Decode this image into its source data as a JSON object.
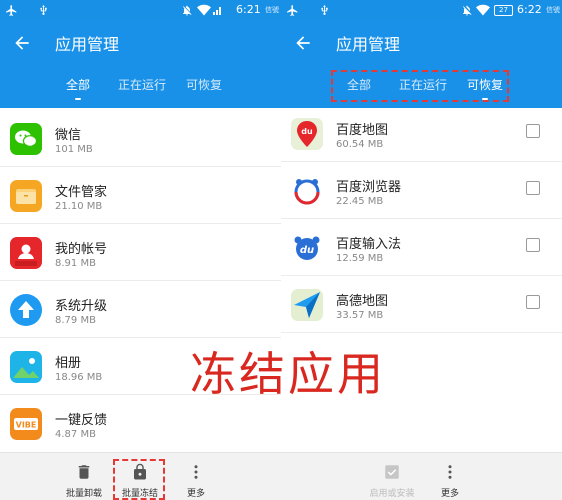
{
  "left": {
    "status": {
      "time": "6:21",
      "carrier_note": "信號"
    },
    "title": "应用管理",
    "tabs": [
      {
        "label": "全部",
        "active": true
      },
      {
        "label": "正在运行",
        "active": false
      },
      {
        "label": "可恢复",
        "active": false
      }
    ],
    "apps": [
      {
        "name": "微信",
        "size": "101 MB",
        "icon": "wechat-icon",
        "color": "#2dc100"
      },
      {
        "name": "文件管家",
        "size": "21.10 MB",
        "icon": "folder-icon",
        "color": "#f5a623"
      },
      {
        "name": "我的帐号",
        "size": "8.91 MB",
        "icon": "lenovo-account-icon",
        "color": "#e5262b"
      },
      {
        "name": "系统升级",
        "size": "8.79 MB",
        "icon": "upgrade-icon",
        "color": "#1e9af0"
      },
      {
        "name": "相册",
        "size": "18.96 MB",
        "icon": "gallery-icon",
        "color": "#1fb4e8"
      },
      {
        "name": "一键反馈",
        "size": "4.87 MB",
        "icon": "vibe-feedback-icon",
        "color": "#f28b1b"
      }
    ],
    "bottom": [
      {
        "label": "批量卸载",
        "icon": "trash-icon"
      },
      {
        "label": "批量冻结",
        "icon": "lock-icon"
      },
      {
        "label": "更多",
        "icon": "more-vertical-icon"
      }
    ]
  },
  "right": {
    "status": {
      "time": "6:22",
      "carrier_note": "信號",
      "battery": "27"
    },
    "title": "应用管理",
    "tabs": [
      {
        "label": "全部",
        "active": false
      },
      {
        "label": "正在运行",
        "active": false
      },
      {
        "label": "可恢复",
        "active": true
      }
    ],
    "apps": [
      {
        "name": "百度地图",
        "size": "60.54 MB",
        "icon": "baidu-map-icon"
      },
      {
        "name": "百度浏览器",
        "size": "22.45 MB",
        "icon": "baidu-browser-icon"
      },
      {
        "name": "百度输入法",
        "size": "12.59 MB",
        "icon": "baidu-input-icon"
      },
      {
        "name": "高德地图",
        "size": "33.57 MB",
        "icon": "amap-icon"
      }
    ],
    "bottom": [
      {
        "label": "启用或安装",
        "icon": "checkmark-icon",
        "disabled": true
      },
      {
        "label": "更多",
        "icon": "more-vertical-icon"
      }
    ]
  },
  "overlay": {
    "text": "冻结应用"
  },
  "colors": {
    "primary": "#1a91e8",
    "annotation": "#e53935"
  }
}
